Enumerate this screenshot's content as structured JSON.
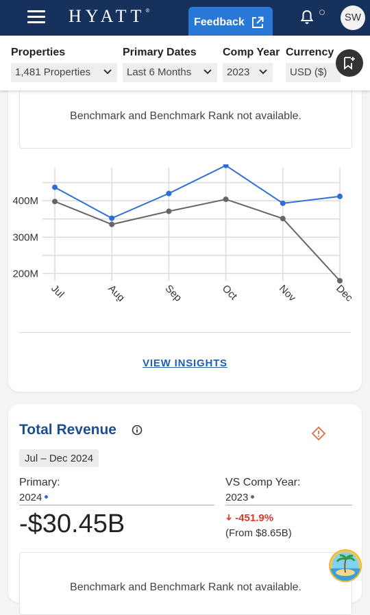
{
  "header": {
    "brand": "HYATT",
    "trademark": "®",
    "feedback_label": "Feedback",
    "avatar_initials": "SW",
    "colors": {
      "navy": "#16325c",
      "feedback_blue": "#2a78d6"
    }
  },
  "filters": [
    {
      "label": "Properties",
      "value": "1,481 Properties"
    },
    {
      "label": "Primary Dates",
      "value": "Last 6 Months"
    },
    {
      "label": "Comp Year",
      "value": "2023"
    },
    {
      "label": "Currency",
      "value": "USD ($)"
    }
  ],
  "occupancy_card": {
    "benchmark_note": "Benchmark and Benchmark Rank not available.",
    "view_insights_label": "VIEW INSIGHTS"
  },
  "chart_data": {
    "type": "line",
    "categories": [
      "Jul",
      "Aug",
      "Sep",
      "Oct",
      "Nov",
      "Dec"
    ],
    "series": [
      {
        "values": [
          437,
          352,
          420,
          497,
          393,
          412
        ],
        "color": "#2d6fd6"
      },
      {
        "values": [
          398,
          335,
          371,
          404,
          351,
          180
        ],
        "color": "#666666"
      }
    ],
    "y_ticks": [
      200,
      300,
      400
    ],
    "y_tick_labels": [
      "200M",
      "300M",
      "400M"
    ],
    "ylim": [
      180,
      500
    ],
    "grid": true
  },
  "total_revenue": {
    "title": "Total Revenue",
    "date_range": "Jul – Dec 2024",
    "primary_label": "Primary:",
    "primary_year": "2024",
    "primary_color": "#2d6fd6",
    "comp_label": "VS Comp Year:",
    "comp_year": "2023",
    "comp_color": "#666666",
    "value": "-$30.45B",
    "delta": "-451.9%",
    "from": "(From $8.65B)",
    "benchmark_note": "Benchmark and Benchmark Rank not available."
  }
}
